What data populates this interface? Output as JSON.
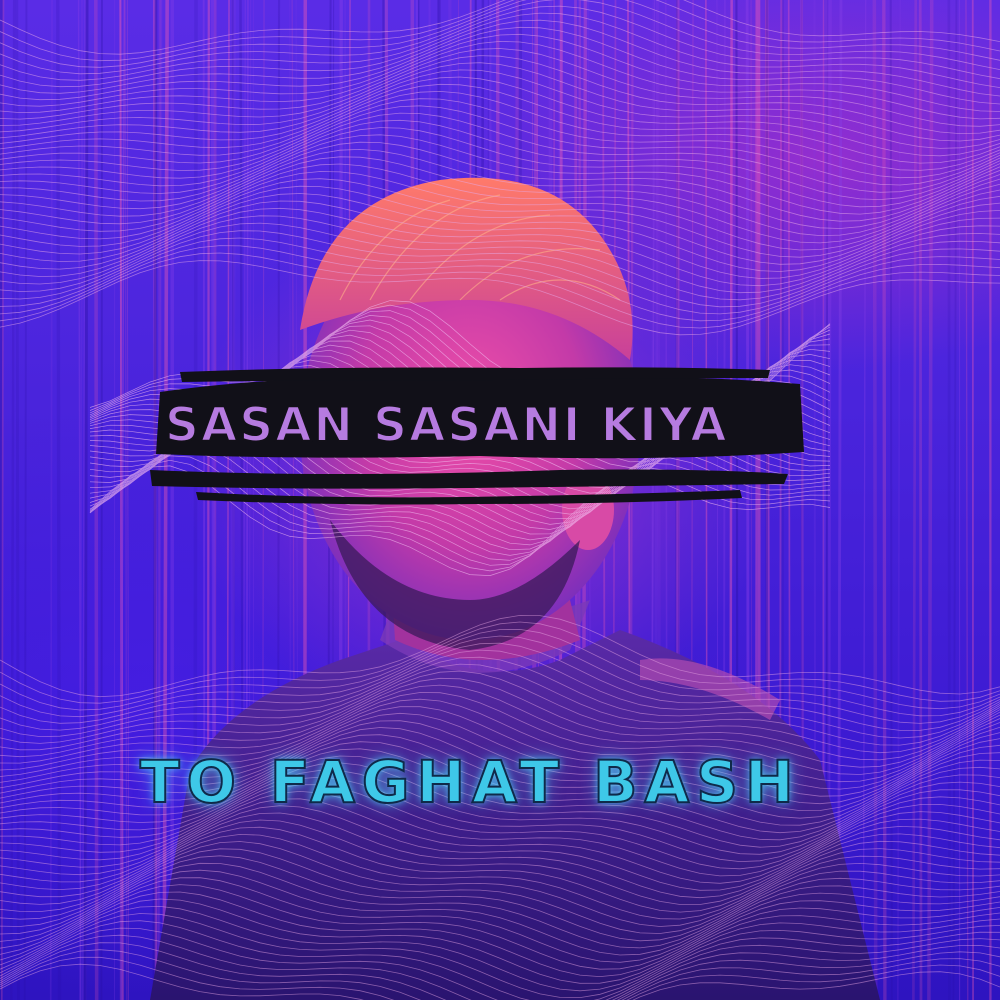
{
  "cover": {
    "artist": "SASAN SASANI KIYA",
    "title": "TO FAGHAT BASH"
  },
  "colors": {
    "background": "#4a24dc",
    "magenta_glow": "#c23cc8",
    "artist_text": "#b67be0",
    "title_neon": "#3ec8e8",
    "brush_stroke": "#111018"
  }
}
